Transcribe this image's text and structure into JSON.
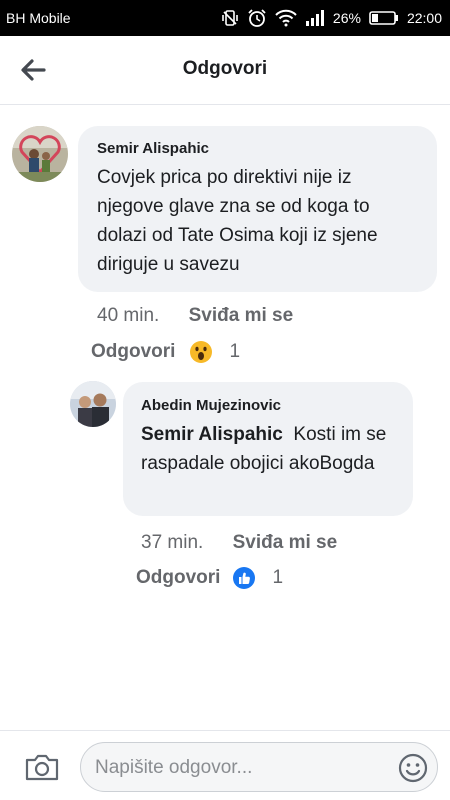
{
  "status_bar": {
    "carrier": "BH Mobile",
    "battery": "26%",
    "time": "22:00"
  },
  "header": {
    "title": "Odgovori"
  },
  "comments": [
    {
      "author": "Semir Alispahic",
      "text": "Covjek prica po direktivi nije iz njegove glave zna se od koga to dolazi od Tate Osima koji iz sjene diriguje u savezu",
      "time": "40 min.",
      "like_label": "Sviđa mi se",
      "reply_label": "Odgovori",
      "reaction": "wow",
      "reaction_count": "1"
    },
    {
      "author": "Abedin Mujezinovic",
      "mention": "Semir Alispahic",
      "text": "Kosti im se raspadale obojici akoBogda",
      "time": "37 min.",
      "like_label": "Sviđa mi se",
      "reply_label": "Odgovori",
      "reaction": "like",
      "reaction_count": "1"
    }
  ],
  "composer": {
    "placeholder": "Napišite odgovor..."
  },
  "colors": {
    "bubble": "#f0f2f5",
    "meta": "#65676b",
    "like_blue": "#1877f2",
    "wow_yellow": "#f7b928"
  }
}
